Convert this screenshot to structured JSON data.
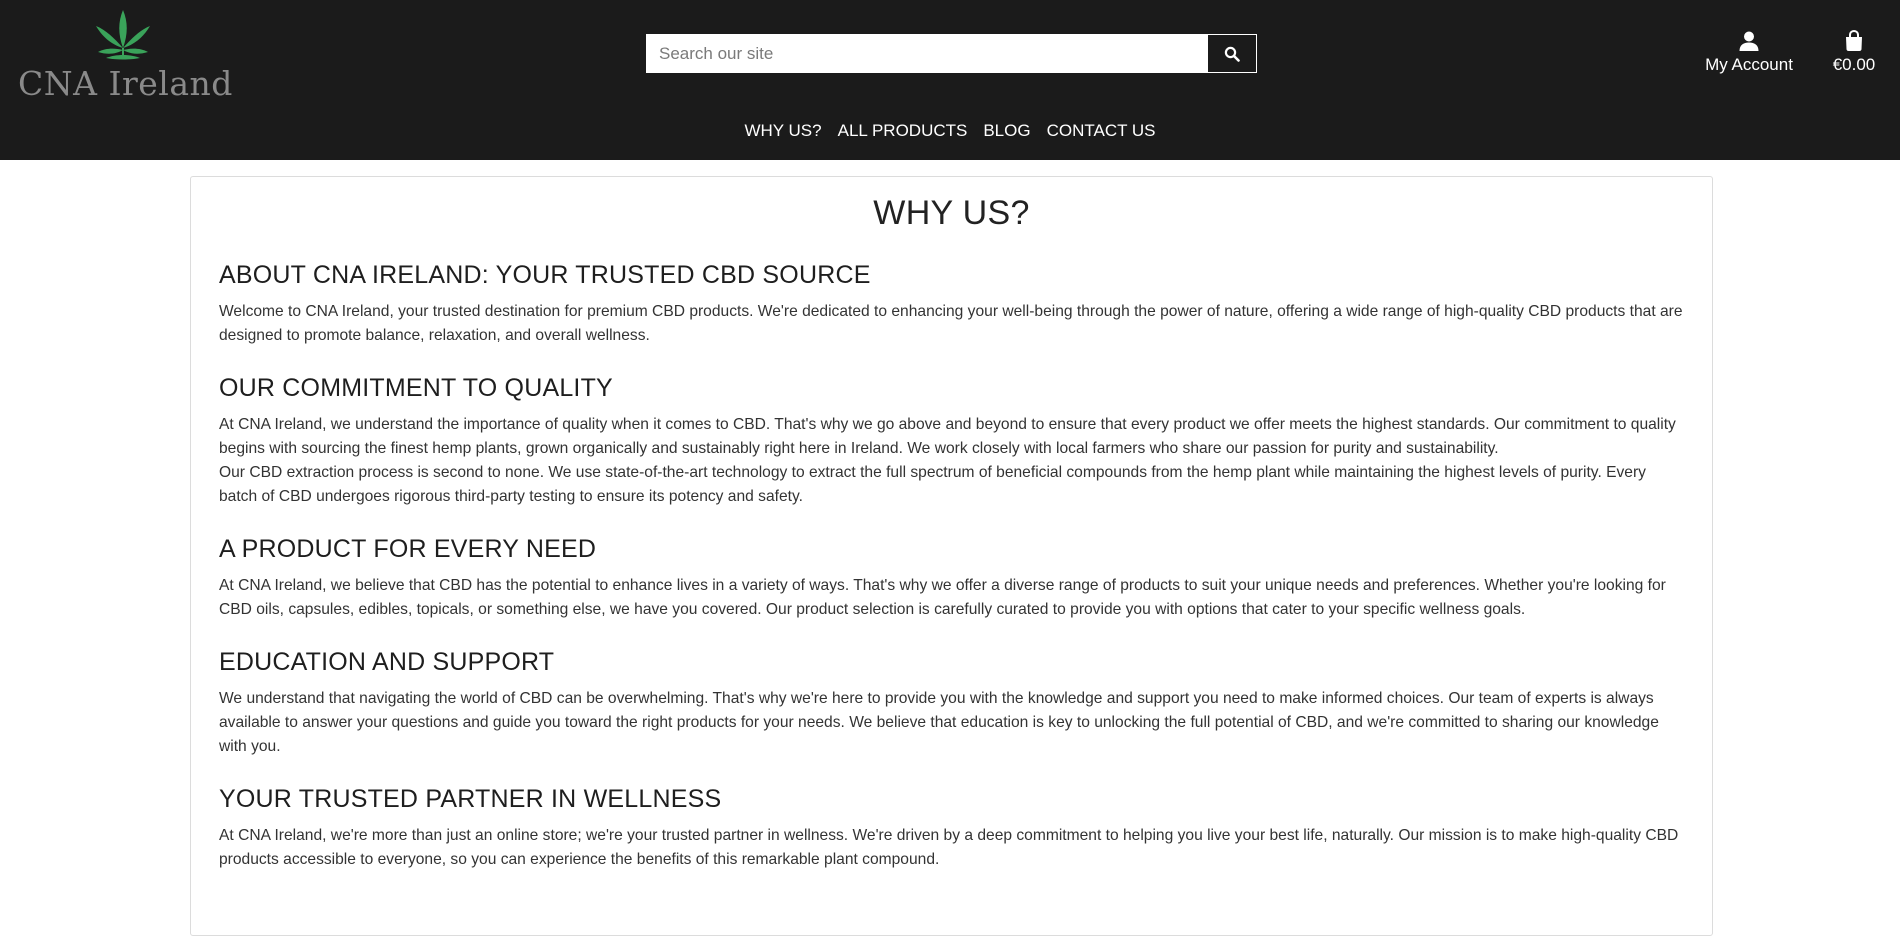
{
  "brand": {
    "name": "CNA Ireland",
    "leaf_color": "#3aa35a"
  },
  "search": {
    "placeholder": "Search our site",
    "value": "",
    "icon": "search-icon"
  },
  "account": {
    "label": "My Account",
    "icon": "user-icon"
  },
  "cart": {
    "total": "€0.00",
    "icon": "shopping-bag-icon"
  },
  "nav": {
    "items": [
      {
        "label": "WHY US?"
      },
      {
        "label": "ALL PRODUCTS"
      },
      {
        "label": "BLOG"
      },
      {
        "label": "CONTACT US"
      }
    ]
  },
  "page": {
    "title": "WHY US?",
    "sections": [
      {
        "heading": "ABOUT CNA IRELAND: YOUR TRUSTED CBD SOURCE",
        "paragraphs": [
          "Welcome to CNA Ireland, your trusted destination for premium CBD products. We're dedicated to enhancing your well-being through the power of nature, offering a wide range of high-quality CBD products that are designed to promote balance, relaxation, and overall wellness."
        ]
      },
      {
        "heading": "OUR COMMITMENT TO QUALITY",
        "paragraphs": [
          "At CNA Ireland, we understand the importance of quality when it comes to CBD. That's why we go above and beyond to ensure that every product we offer meets the highest standards. Our commitment to quality begins with sourcing the finest hemp plants, grown organically and sustainably right here in Ireland. We work closely with local farmers who share our passion for purity and sustainability.",
          "Our CBD extraction process is second to none. We use state-of-the-art technology to extract the full spectrum of beneficial compounds from the hemp plant while maintaining the highest levels of purity. Every batch of CBD undergoes rigorous third-party testing to ensure its potency and safety."
        ]
      },
      {
        "heading": "A PRODUCT FOR EVERY NEED",
        "paragraphs": [
          "At CNA Ireland, we believe that CBD has the potential to enhance lives in a variety of ways. That's why we offer a diverse range of products to suit your unique needs and preferences. Whether you're looking for CBD oils, capsules, edibles, topicals, or something else, we have you covered. Our product selection is carefully curated to provide you with options that cater to your specific wellness goals."
        ]
      },
      {
        "heading": "EDUCATION AND SUPPORT",
        "paragraphs": [
          "We understand that navigating the world of CBD can be overwhelming. That's why we're here to provide you with the knowledge and support you need to make informed choices. Our team of experts is always available to answer your questions and guide you toward the right products for your needs. We believe that education is key to unlocking the full potential of CBD, and we're committed to sharing our knowledge with you."
        ]
      },
      {
        "heading": "YOUR TRUSTED PARTNER IN WELLNESS",
        "paragraphs": [
          "At CNA Ireland, we're more than just an online store; we're your trusted partner in wellness. We're driven by a deep commitment to helping you live your best life, naturally. Our mission is to make high-quality CBD products accessible to everyone, so you can experience the benefits of this remarkable plant compound."
        ]
      }
    ]
  }
}
